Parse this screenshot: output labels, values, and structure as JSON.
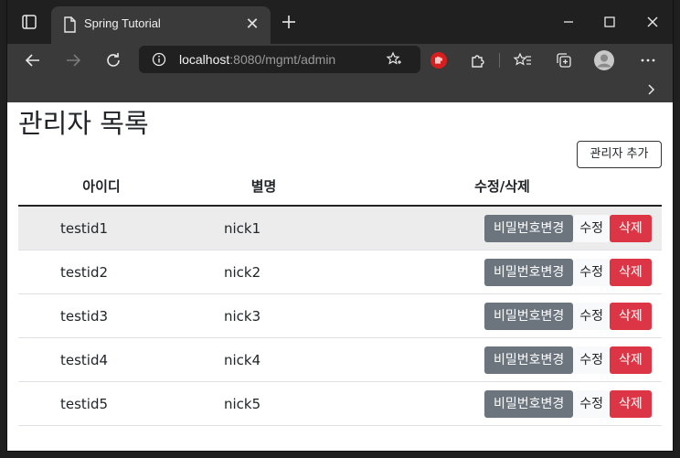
{
  "browser": {
    "tab_title": "Spring Tutorial",
    "address_host": "localhost",
    "address_rest": ":8080/mgmt/admin"
  },
  "page": {
    "title": "관리자 목록",
    "add_button": "관리자 추가",
    "columns": [
      "아이디",
      "별명",
      "수정/삭제"
    ],
    "rows": [
      {
        "id": "testid1",
        "nick": "nick1"
      },
      {
        "id": "testid2",
        "nick": "nick2"
      },
      {
        "id": "testid3",
        "nick": "nick3"
      },
      {
        "id": "testid4",
        "nick": "nick4"
      },
      {
        "id": "testid5",
        "nick": "nick5"
      }
    ],
    "row_buttons": {
      "password": "비밀번호변경",
      "edit": "수정",
      "delete": "삭제"
    }
  },
  "colors": {
    "danger": "#dc3545",
    "secondary": "#6c757d",
    "chrome_dark": "#202020",
    "chrome_mid": "#3a3a3a"
  }
}
